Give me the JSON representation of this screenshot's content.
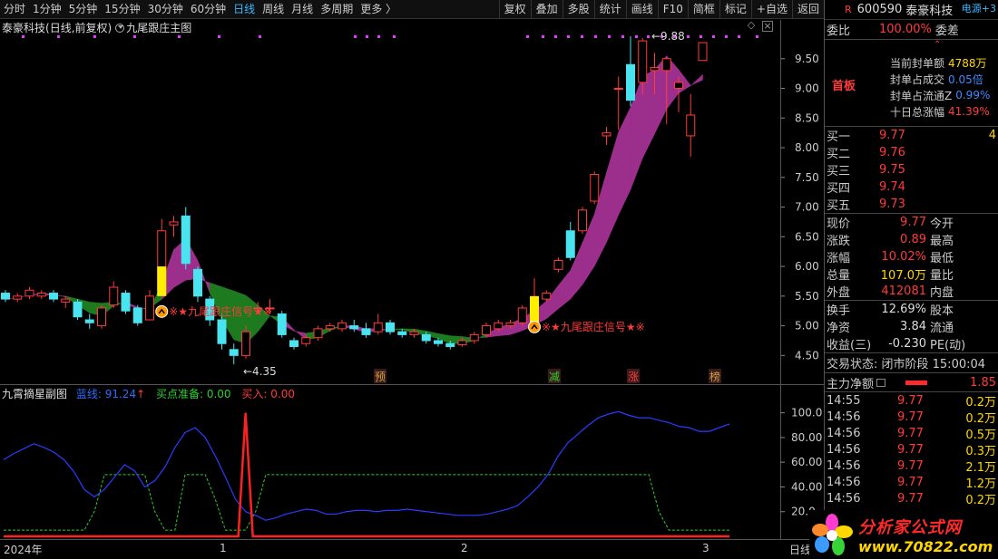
{
  "toolbar": {
    "left": [
      "分时",
      "1分钟",
      "5分钟",
      "15分钟",
      "30分钟",
      "60分钟",
      "日线",
      "周线",
      "月线",
      "多周期",
      "更多 〉"
    ],
    "active_index": 6,
    "right": [
      "复权",
      "叠加",
      "多股",
      "统计",
      "画线",
      "F10",
      "简框",
      "标记",
      "+自选",
      "返回"
    ]
  },
  "main": {
    "title_stock": "泰豪科技",
    "title_mode": "(日线,前复权)",
    "title_indicator": "九尾跟庄主图",
    "price_ticks": [
      "9.50",
      "9.00",
      "8.50",
      "8.00",
      "7.50",
      "7.00",
      "6.50",
      "6.00",
      "5.50",
      "5.00",
      "4.50"
    ],
    "high_label": "9.88",
    "low_label": "4.35",
    "signal_text": "※★九尾跟庄信号★※",
    "markers": [
      "预",
      "减",
      "涨",
      "榜"
    ]
  },
  "sub": {
    "name": "九霄摘星副图",
    "v1_label": "蓝线:",
    "v1_value": "91.24",
    "v1_arrow": "↑",
    "v2_label": "买点准备:",
    "v2_value": "0.00",
    "v3_label": "买入:",
    "v3_value": "0.00",
    "ticks": [
      "100.0",
      "80.00",
      "60.00",
      "40.00",
      "20.0"
    ]
  },
  "xaxis": {
    "labels": [
      "2024年",
      "1",
      "2",
      "3"
    ],
    "right_label": "日线"
  },
  "chart_data": {
    "type": "candlestick",
    "title": "九尾跟庄主图",
    "ylim": [
      4.2,
      10.0
    ],
    "candles": [
      {
        "o": 5.55,
        "c": 5.45,
        "h": 5.6,
        "l": 5.4
      },
      {
        "o": 5.45,
        "c": 5.5,
        "h": 5.55,
        "l": 5.4
      },
      {
        "o": 5.5,
        "c": 5.6,
        "h": 5.65,
        "l": 5.45
      },
      {
        "o": 5.5,
        "c": 5.55,
        "h": 5.6,
        "l": 5.45
      },
      {
        "o": 5.55,
        "c": 5.45,
        "h": 5.6,
        "l": 5.4
      },
      {
        "o": 5.4,
        "c": 5.45,
        "h": 5.5,
        "l": 5.3
      },
      {
        "o": 5.4,
        "c": 5.15,
        "h": 5.45,
        "l": 5.1
      },
      {
        "o": 5.1,
        "c": 5.05,
        "h": 5.2,
        "l": 4.95
      },
      {
        "o": 5.0,
        "c": 5.3,
        "h": 5.35,
        "l": 4.95
      },
      {
        "o": 5.35,
        "c": 5.65,
        "h": 5.75,
        "l": 5.3
      },
      {
        "o": 5.55,
        "c": 5.25,
        "h": 5.6,
        "l": 5.2
      },
      {
        "o": 5.3,
        "c": 5.05,
        "h": 5.35,
        "l": 5.0
      },
      {
        "o": 5.1,
        "c": 5.5,
        "h": 5.6,
        "l": 5.1
      },
      {
        "o": 5.6,
        "c": 6.6,
        "h": 6.8,
        "l": 5.6
      },
      {
        "o": 6.7,
        "c": 6.75,
        "h": 6.85,
        "l": 6.5
      },
      {
        "o": 6.85,
        "c": 6.05,
        "h": 7.0,
        "l": 5.95
      },
      {
        "o": 5.95,
        "c": 5.5,
        "h": 6.0,
        "l": 5.4
      },
      {
        "o": 5.45,
        "c": 5.1,
        "h": 5.5,
        "l": 5.0
      },
      {
        "o": 5.1,
        "c": 4.7,
        "h": 5.2,
        "l": 4.6
      },
      {
        "o": 4.6,
        "c": 4.5,
        "h": 4.7,
        "l": 4.35
      },
      {
        "o": 4.5,
        "c": 4.9,
        "h": 5.0,
        "l": 4.45
      },
      {
        "o": 5.3,
        "c": 5.3,
        "h": 5.4,
        "l": 5.2
      },
      {
        "o": 5.3,
        "c": 5.3,
        "h": 5.45,
        "l": 5.2
      },
      {
        "o": 5.2,
        "c": 4.85,
        "h": 5.25,
        "l": 4.8
      },
      {
        "o": 4.75,
        "c": 4.65,
        "h": 4.8,
        "l": 4.6
      },
      {
        "o": 4.7,
        "c": 4.8,
        "h": 4.85,
        "l": 4.65
      },
      {
        "o": 4.8,
        "c": 4.95,
        "h": 5.0,
        "l": 4.75
      },
      {
        "o": 4.95,
        "c": 5.0,
        "h": 5.05,
        "l": 4.9
      },
      {
        "o": 4.95,
        "c": 5.05,
        "h": 5.1,
        "l": 4.9
      },
      {
        "o": 5.0,
        "c": 4.95,
        "h": 5.1,
        "l": 4.9
      },
      {
        "o": 4.95,
        "c": 4.85,
        "h": 5.05,
        "l": 4.8
      },
      {
        "o": 4.9,
        "c": 5.05,
        "h": 5.2,
        "l": 4.85
      },
      {
        "o": 5.05,
        "c": 4.9,
        "h": 5.1,
        "l": 4.85
      },
      {
        "o": 4.9,
        "c": 4.85,
        "h": 4.95,
        "l": 4.8
      },
      {
        "o": 4.85,
        "c": 4.9,
        "h": 4.95,
        "l": 4.8
      },
      {
        "o": 4.85,
        "c": 4.75,
        "h": 4.9,
        "l": 4.7
      },
      {
        "o": 4.75,
        "c": 4.7,
        "h": 4.8,
        "l": 4.65
      },
      {
        "o": 4.7,
        "c": 4.65,
        "h": 4.75,
        "l": 4.6
      },
      {
        "o": 4.68,
        "c": 4.75,
        "h": 4.8,
        "l": 4.65
      },
      {
        "o": 4.75,
        "c": 4.85,
        "h": 4.9,
        "l": 4.7
      },
      {
        "o": 4.85,
        "c": 5.0,
        "h": 5.05,
        "l": 4.8
      },
      {
        "o": 4.95,
        "c": 5.05,
        "h": 5.1,
        "l": 4.9
      },
      {
        "o": 5.0,
        "c": 5.05,
        "h": 5.1,
        "l": 4.95
      },
      {
        "o": 5.05,
        "c": 5.3,
        "h": 5.35,
        "l": 5.0
      },
      {
        "o": 5.3,
        "c": 5.4,
        "h": 5.8,
        "l": 5.25
      },
      {
        "o": 5.45,
        "c": 5.55,
        "h": 5.6,
        "l": 5.4
      },
      {
        "o": 5.95,
        "c": 6.1,
        "h": 6.15,
        "l": 5.9
      },
      {
        "o": 6.6,
        "c": 6.15,
        "h": 6.75,
        "l": 6.1
      },
      {
        "o": 6.6,
        "c": 6.95,
        "h": 7.0,
        "l": 6.55
      },
      {
        "o": 7.1,
        "c": 7.55,
        "h": 7.6,
        "l": 7.05
      },
      {
        "o": 8.2,
        "c": 8.25,
        "h": 8.35,
        "l": 8.05
      },
      {
        "o": 9.0,
        "c": 9.0,
        "h": 9.2,
        "l": 8.3
      },
      {
        "o": 9.4,
        "c": 8.8,
        "h": 9.88,
        "l": 8.7
      },
      {
        "o": 9.1,
        "c": 9.8,
        "h": 9.85,
        "l": 8.9
      },
      {
        "o": 9.3,
        "c": 9.35,
        "h": 9.6,
        "l": 8.9
      },
      {
        "o": 9.3,
        "c": 9.5,
        "h": 9.5,
        "l": 8.4
      },
      {
        "o": 9.0,
        "c": 9.1,
        "h": 9.2,
        "l": 8.6
      },
      {
        "o": 8.2,
        "c": 8.55,
        "h": 8.9,
        "l": 7.85
      },
      {
        "o": 9.47,
        "c": 9.77,
        "h": 9.77,
        "l": 9.47
      }
    ],
    "sub_series": {
      "blue_line": [
        62,
        67,
        71,
        75,
        72,
        68,
        62,
        52,
        38,
        32,
        38,
        48,
        58,
        53,
        40,
        45,
        56,
        72,
        84,
        88,
        80,
        65,
        48,
        30,
        20,
        17,
        13,
        15,
        18,
        20,
        22,
        21,
        18,
        18,
        20,
        21,
        21,
        20,
        21,
        21,
        22,
        21,
        20,
        19,
        18,
        17,
        17,
        17,
        18,
        20,
        22,
        25,
        32,
        40,
        50,
        65,
        76,
        83,
        90,
        96,
        99,
        101,
        98,
        96,
        96,
        94,
        92,
        89,
        88,
        85,
        85,
        88,
        91
      ],
      "green_line": [
        5,
        5,
        5,
        5,
        5,
        5,
        5,
        5,
        5,
        20,
        50,
        50,
        50,
        50,
        50,
        20,
        5,
        5,
        50,
        50,
        50,
        30,
        5,
        5,
        5,
        20,
        50,
        50,
        50,
        50,
        50,
        50,
        50,
        50,
        50,
        50,
        50,
        50,
        50,
        50,
        50,
        50,
        50,
        50,
        50,
        50,
        50,
        50,
        50,
        50,
        50,
        50,
        50,
        50,
        50,
        50,
        50,
        50,
        50,
        50,
        50,
        50,
        50,
        50,
        50,
        20,
        5,
        5,
        5,
        5,
        5,
        5,
        5
      ],
      "red_spike_index": 24
    }
  },
  "panel": {
    "code": "600590",
    "name": "泰豪科技",
    "source": "电源",
    "weibi_label": "委比",
    "weibi_value": "100.00%",
    "weicha_label": "委差",
    "shouban": "首板",
    "info": [
      {
        "label": "当前封单额",
        "value": "4788万"
      },
      {
        "label": "封单占成交",
        "value": "0.05倍"
      },
      {
        "label": "封单占流通Z",
        "value": "0.99%"
      },
      {
        "label": "十日总涨幅",
        "value": "41.39%"
      }
    ],
    "bids": [
      {
        "label": "买一",
        "price": "9.77",
        "vol": "4"
      },
      {
        "label": "买二",
        "price": "9.76",
        "vol": ""
      },
      {
        "label": "买三",
        "price": "9.75",
        "vol": ""
      },
      {
        "label": "买四",
        "price": "9.74",
        "vol": ""
      },
      {
        "label": "买五",
        "price": "9.73",
        "vol": ""
      }
    ],
    "stats": [
      {
        "l1": "现价",
        "v1": "9.77",
        "l2": "今开"
      },
      {
        "l1": "涨跌",
        "v1": "0.89",
        "l2": "最高"
      },
      {
        "l1": "涨幅",
        "v1": "10.02%",
        "l2": "最低"
      },
      {
        "l1": "总量",
        "v1": "107.0万",
        "l2": "量比"
      },
      {
        "l1": "外盘",
        "v1": "412081",
        "l2": "内盘"
      }
    ],
    "stats2": [
      {
        "l1": "换手",
        "v1": "12.69%",
        "l2": "股本"
      },
      {
        "l1": "净资",
        "v1": "3.84",
        "l2": "流通"
      },
      {
        "l1": "收益(三)",
        "v1": "-0.230",
        "l2": "PE(动)"
      }
    ],
    "status": "交易状态: 闭市阶段 15:00:04",
    "flow_label": "主力净额",
    "flow_value": "1.85",
    "ticks": [
      {
        "t": "14:55",
        "p": "9.77",
        "v": "0.2万"
      },
      {
        "t": "14:56",
        "p": "9.77",
        "v": "0.2万"
      },
      {
        "t": "14:56",
        "p": "9.77",
        "v": "0.5万"
      },
      {
        "t": "14:56",
        "p": "9.77",
        "v": "0.3万"
      },
      {
        "t": "14:56",
        "p": "9.77",
        "v": "2.1万"
      },
      {
        "t": "14:56",
        "p": "9.77",
        "v": "1.2万"
      },
      {
        "t": "14:56",
        "p": "9.77",
        "v": "0.2万"
      }
    ]
  },
  "brand": {
    "t1": "分析家公式网",
    "t2": "www.70822.com"
  }
}
